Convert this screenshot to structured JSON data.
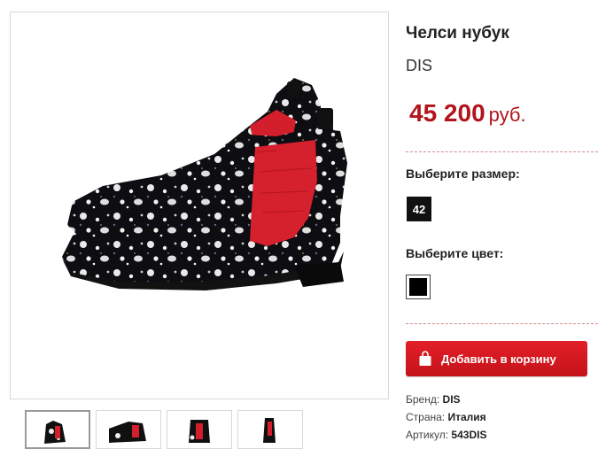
{
  "product": {
    "title": "Челси нубук",
    "brand": "DIS",
    "price_value": "45 200",
    "price_currency": "руб."
  },
  "options": {
    "size_label": "Выберите размер:",
    "sizes": [
      "42"
    ],
    "color_label": "Выберите цвет:",
    "colors": [
      {
        "name": "black",
        "hex": "#000000"
      }
    ]
  },
  "cart": {
    "button_label": "Добавить в корзину",
    "icon": "shopping-bag-icon",
    "accent": "#d4161e"
  },
  "details": [
    {
      "label": "Бренд:",
      "value": "DIS"
    },
    {
      "label": "Страна:",
      "value": "Италия"
    },
    {
      "label": "Артикул:",
      "value": "543DIS"
    }
  ],
  "gallery": {
    "thumbnail_count": 4,
    "active_index": 0
  }
}
